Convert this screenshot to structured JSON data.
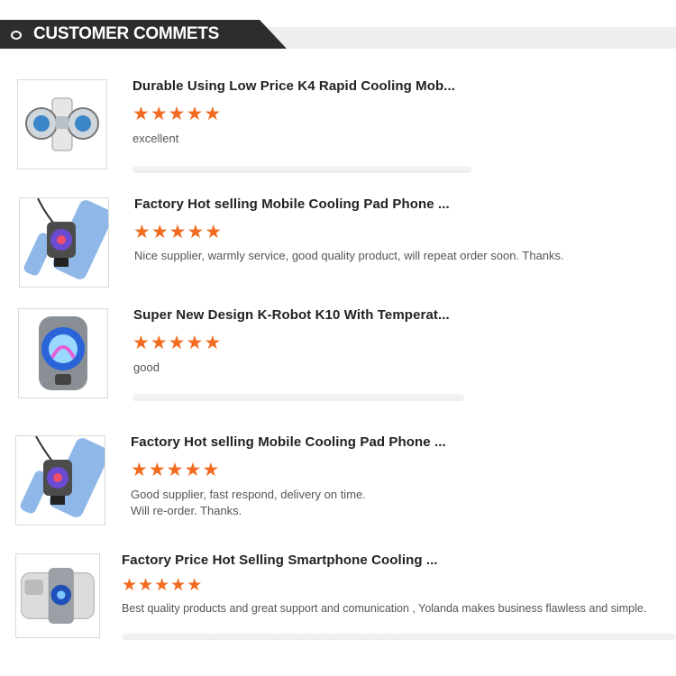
{
  "header": {
    "title": "CUSTOMER COMMETS"
  },
  "reviews": [
    {
      "title": "Durable Using Low Price K4 Rapid Cooling Mob...",
      "rating": 5,
      "text": "excellent",
      "image": "cooling-fan-product-image"
    },
    {
      "title": "Factory Hot selling Mobile Cooling Pad Phone ...",
      "rating": 5,
      "text": "Nice supplier, warmly service, good quality product, will repeat order soon. Thanks.",
      "image": "phone-cooler-product-image"
    },
    {
      "title": "Super New Design K-Robot K10 With Temperat...",
      "rating": 5,
      "text": "good",
      "image": "rgb-cooler-product-image"
    },
    {
      "title": "Factory Hot selling Mobile Cooling Pad Phone ...",
      "rating": 5,
      "text": "Good supplier, fast respond, delivery on time.\nWill re-order. Thanks.",
      "image": "phone-cooler-product-image"
    },
    {
      "title": "Factory Price Hot Selling Smartphone Cooling ...",
      "rating": 5,
      "text": "Best quality products and great support and comunication , Yolanda makes business flawless and simple.",
      "image": "smartphone-cooler-product-image"
    }
  ],
  "colors": {
    "star": "#f26b21",
    "header_dark": "#2d2d2d",
    "header_light": "#efefef"
  }
}
